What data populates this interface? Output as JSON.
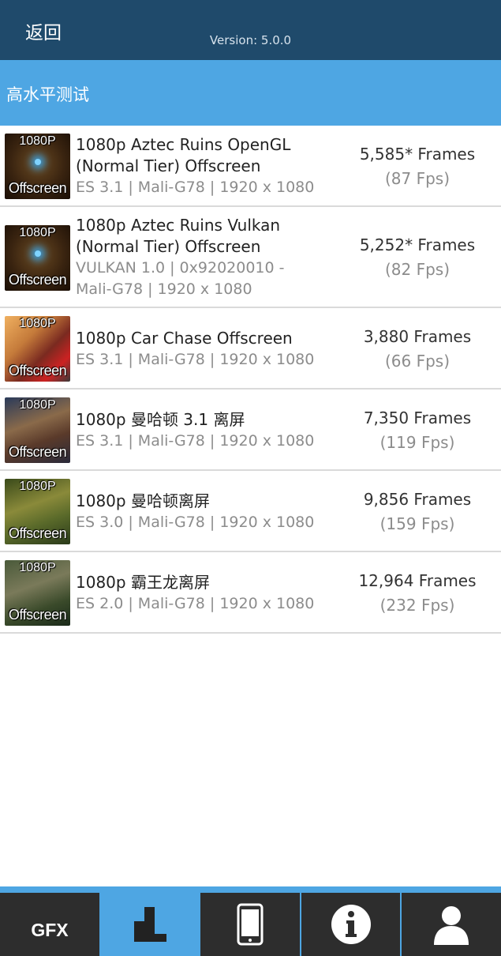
{
  "header": {
    "back_label": "返回",
    "version": "Version: 5.0.0"
  },
  "section": {
    "title": "高水平测试"
  },
  "tests": [
    {
      "name_lines": [
        "1080p Aztec Ruins OpenGL",
        "(Normal Tier) Offscreen"
      ],
      "spec_lines": [
        "ES 3.1 | Mali-G78 | 1920 x 1080"
      ],
      "frames": "5,585* Frames",
      "fps": "(87 Fps)",
      "thumb_res": "1080P",
      "thumb_off": "Offscreen",
      "thumb_style": "aztec"
    },
    {
      "name_lines": [
        "1080p Aztec Ruins Vulkan",
        "(Normal Tier) Offscreen"
      ],
      "spec_lines": [
        "VULKAN 1.0 | 0x92020010 -",
        "Mali-G78 | 1920 x 1080"
      ],
      "frames": "5,252* Frames",
      "fps": "(82 Fps)",
      "thumb_res": "1080P",
      "thumb_off": "Offscreen",
      "thumb_style": "aztec"
    },
    {
      "name_lines": [
        "1080p Car Chase Offscreen"
      ],
      "spec_lines": [
        "ES 3.1 | Mali-G78 | 1920 x 1080"
      ],
      "frames": "3,880 Frames",
      "fps": "(66 Fps)",
      "thumb_res": "1080P",
      "thumb_off": "Offscreen",
      "thumb_style": "car"
    },
    {
      "name_lines": [
        "1080p 曼哈顿 3.1 离屏"
      ],
      "spec_lines": [
        "ES 3.1 | Mali-G78 | 1920 x 1080"
      ],
      "frames": "7,350 Frames",
      "fps": "(119 Fps)",
      "thumb_res": "1080P",
      "thumb_off": "Offscreen",
      "thumb_style": "man31"
    },
    {
      "name_lines": [
        "1080p 曼哈顿离屏"
      ],
      "spec_lines": [
        "ES 3.0 | Mali-G78 | 1920 x 1080"
      ],
      "frames": "9,856 Frames",
      "fps": "(159 Fps)",
      "thumb_res": "1080P",
      "thumb_off": "Offscreen",
      "thumb_style": "man"
    },
    {
      "name_lines": [
        "1080p 霸王龙离屏"
      ],
      "spec_lines": [
        "ES 2.0 | Mali-G78 | 1920 x 1080"
      ],
      "frames": "12,964 Frames",
      "fps": "(232 Fps)",
      "thumb_res": "1080P",
      "thumb_off": "Offscreen",
      "thumb_style": "trex"
    }
  ],
  "bottom_nav": {
    "gfx_label": "GFX",
    "icons": [
      "gfx-tab",
      "bar-chart-icon",
      "phone-icon",
      "info-icon",
      "user-icon"
    ],
    "active_index": 1
  },
  "colors": {
    "header_bg": "#1f4a6b",
    "accent": "#4ea6e3",
    "nav_bg": "#2d2d2d"
  }
}
